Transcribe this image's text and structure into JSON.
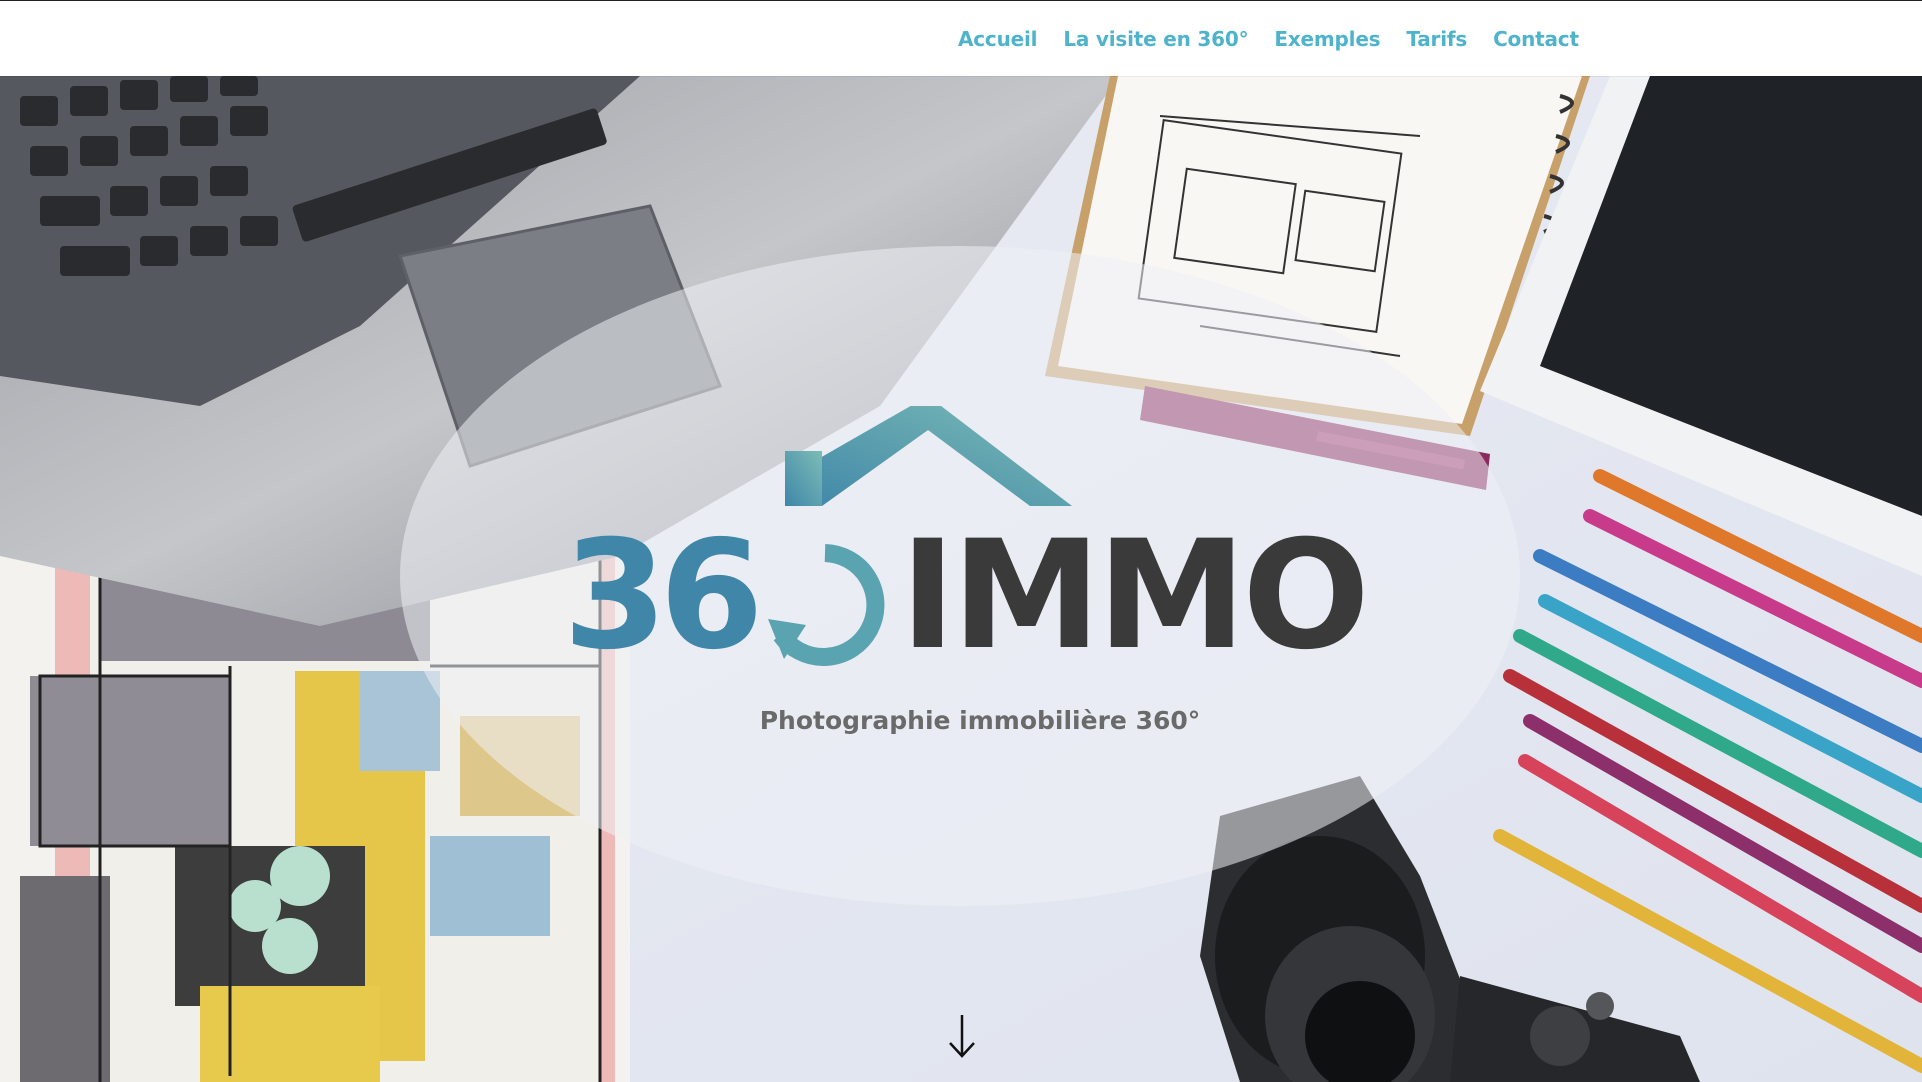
{
  "nav": {
    "items": [
      {
        "label": "Accueil"
      },
      {
        "label": "La visite en 360°"
      },
      {
        "label": "Exemples"
      },
      {
        "label": "Tarifs"
      },
      {
        "label": "Contact"
      }
    ]
  },
  "hero": {
    "logo_text": "360 IMMO",
    "tagline": "Photographie immobilière 360°"
  },
  "colors": {
    "nav_link": "#4fb3cb",
    "logo_teal": "#5aa3b0",
    "logo_blue": "#3f86a8",
    "logo_dark": "#3a3a3a"
  },
  "icons": {
    "scroll": "arrow-down-icon"
  }
}
